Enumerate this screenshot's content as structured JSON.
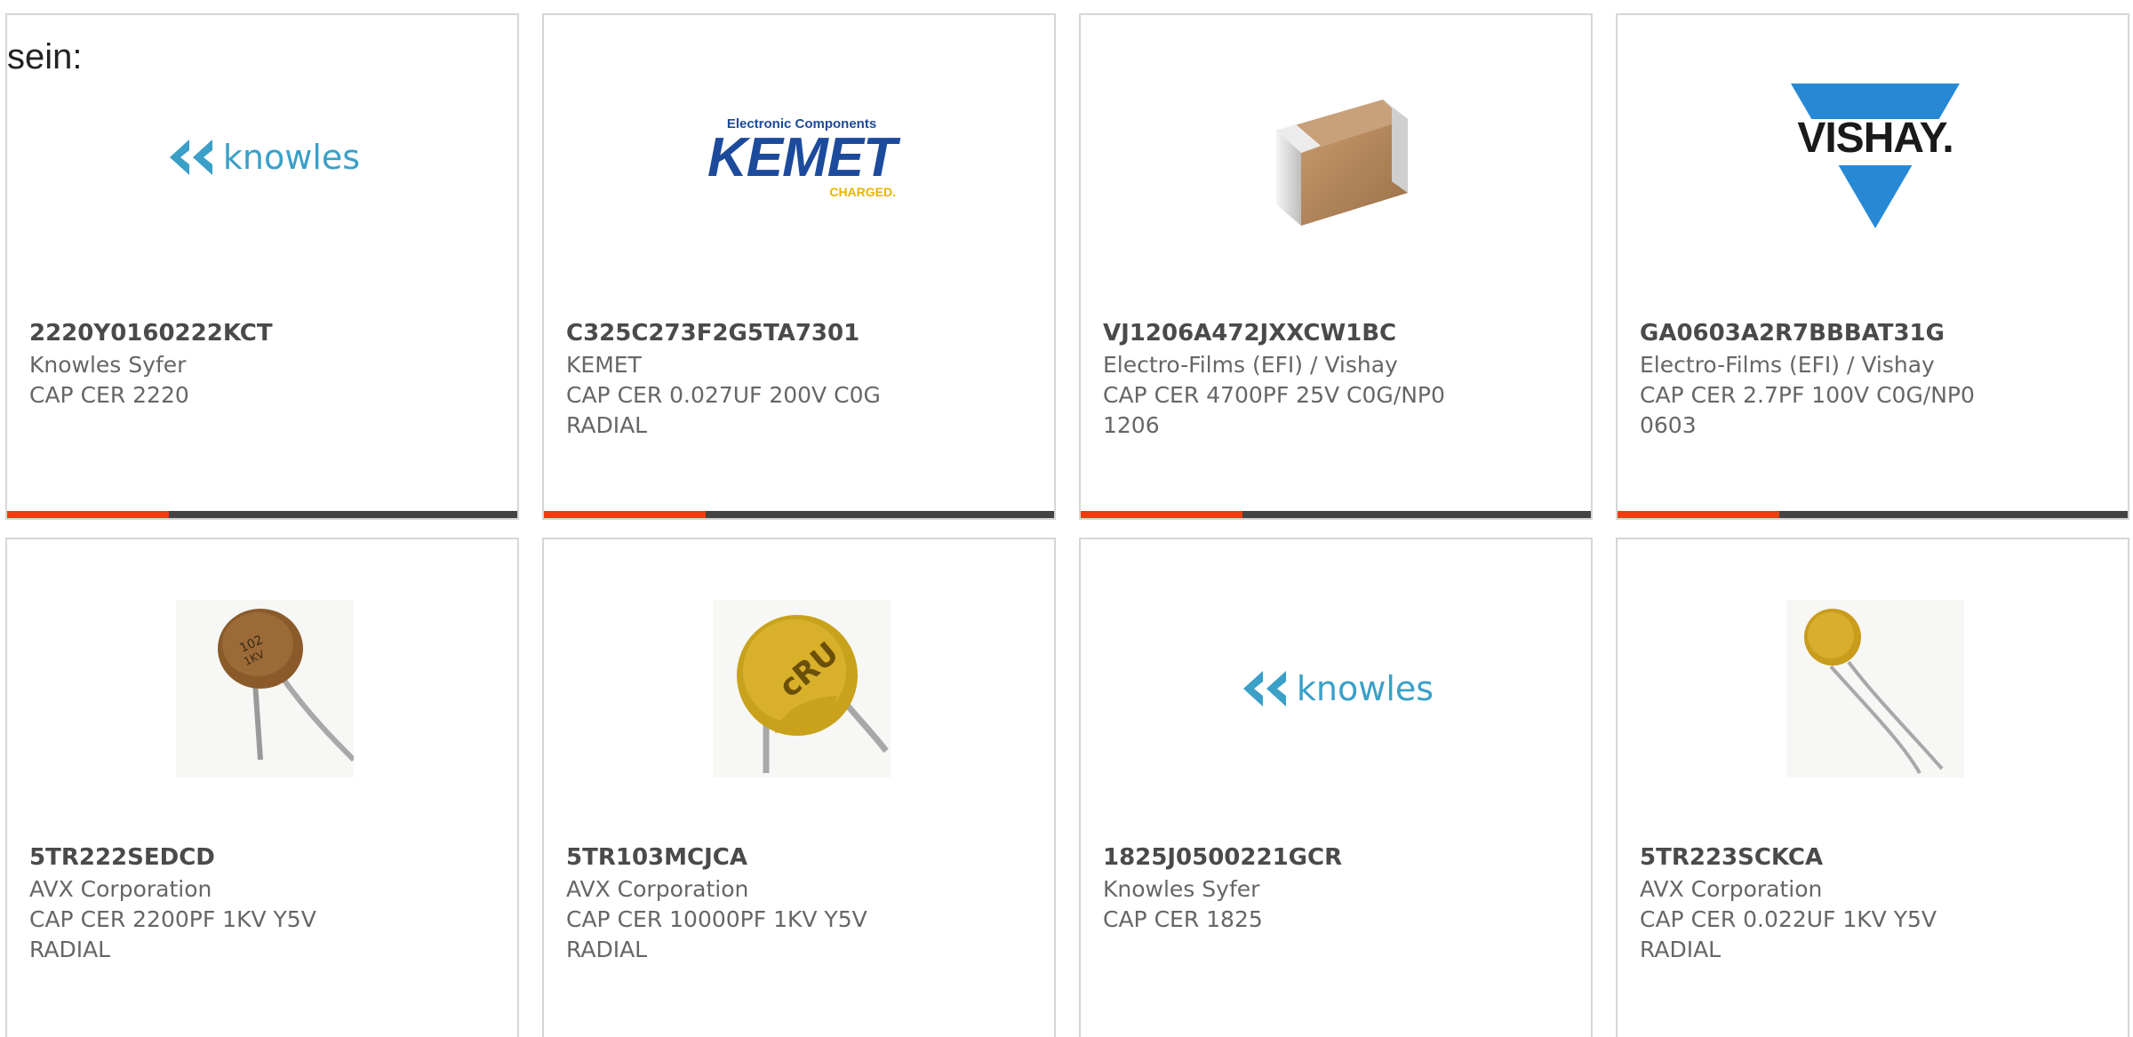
{
  "intro_text": "sein:",
  "accent_color": "#e8410f",
  "bar_color": "#444444",
  "products": [
    {
      "part": "2220Y0160222KCT",
      "manufacturer": "Knowles Syfer",
      "description": "CAP CER 2220",
      "image": "knowles-logo"
    },
    {
      "part": "C325C273F2G5TA7301",
      "manufacturer": "KEMET",
      "description": "CAP CER 0.027UF 200V C0G RADIAL",
      "image": "kemet-logo"
    },
    {
      "part": "VJ1206A472JXXCW1BC",
      "manufacturer": "Electro-Films (EFI) / Vishay",
      "description": "CAP CER 4700PF 25V C0G/NP0 1206",
      "image": "smd-capacitor-photo"
    },
    {
      "part": "GA0603A2R7BBBAT31G",
      "manufacturer": "Electro-Films (EFI) / Vishay",
      "description": "CAP CER 2.7PF 100V C0G/NP0 0603",
      "image": "vishay-logo"
    },
    {
      "part": "5TR222SEDCD",
      "manufacturer": "AVX Corporation",
      "description": "CAP CER 2200PF 1KV Y5V RADIAL",
      "image": "disc-capacitor-brown-photo"
    },
    {
      "part": "5TR103MCJCA",
      "manufacturer": "AVX Corporation",
      "description": "CAP CER 10000PF 1KV Y5V RADIAL",
      "image": "disc-capacitor-yellow-photo"
    },
    {
      "part": "1825J0500221GCR",
      "manufacturer": "Knowles Syfer",
      "description": "CAP CER 1825",
      "image": "knowles-logo"
    },
    {
      "part": "5TR223SCKCA",
      "manufacturer": "AVX Corporation",
      "description": "CAP CER 0.022UF 1KV Y5V RADIAL",
      "image": "disc-capacitor-small-photo"
    }
  ],
  "logos": {
    "knowles": "knowles",
    "kemet_top": "Electronic Components",
    "kemet_main": "KEMET",
    "kemet_sub": "CHARGED.",
    "vishay": "VISHAY."
  }
}
